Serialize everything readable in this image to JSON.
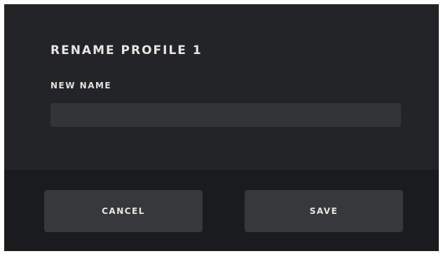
{
  "dialog": {
    "title": "RENAME PROFILE 1",
    "field_label": "NEW NAME",
    "name_input": {
      "value": "",
      "placeholder": ""
    },
    "cancel_label": "CANCEL",
    "save_label": "SAVE"
  },
  "colors": {
    "dialog_body_bg": "#232426",
    "dialog_footer_bg": "#1a1b1d",
    "input_bg": "#333436",
    "button_bg": "#37383a",
    "text": "#e6e6e6"
  }
}
